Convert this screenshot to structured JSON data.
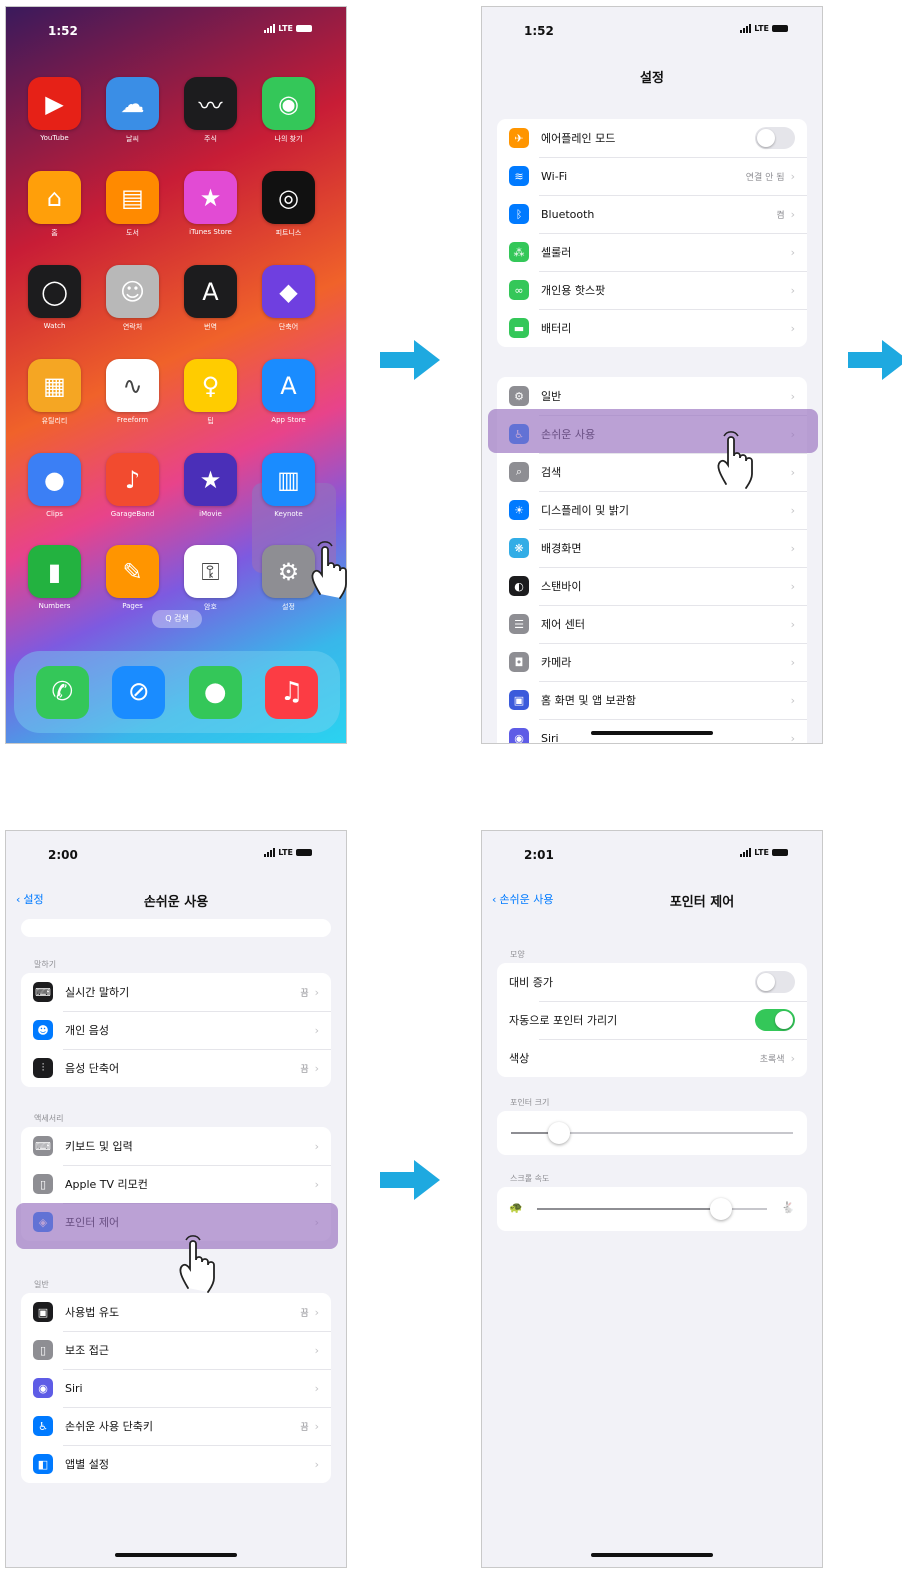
{
  "colors": {
    "arrow": "#1ea9e0",
    "highlight": "#9b6fc2",
    "ios_blue": "#007aff",
    "toggle_on": "#34c759"
  },
  "phone1": {
    "time": "1:52",
    "network": "LTE",
    "apps": [
      {
        "label": "YouTube",
        "icon": "play-icon",
        "color": "#e62117",
        "glyph": "▶"
      },
      {
        "label": "날씨",
        "icon": "weather-icon",
        "color": "#3a8ee6",
        "glyph": "☁"
      },
      {
        "label": "주식",
        "icon": "stocks-icon",
        "color": "#1c1c1e",
        "glyph": "〰"
      },
      {
        "label": "나의 찾기",
        "icon": "findmy-icon",
        "color": "#34c759",
        "glyph": "◉"
      },
      {
        "label": "홈",
        "icon": "home-icon",
        "color": "#ff9f0a",
        "glyph": "⌂"
      },
      {
        "label": "도서",
        "icon": "books-icon",
        "color": "#ff8a00",
        "glyph": "▤"
      },
      {
        "label": "iTunes Store",
        "icon": "star-icon",
        "color": "#e24bd4",
        "glyph": "★"
      },
      {
        "label": "피트니스",
        "icon": "fitness-icon",
        "color": "#111111",
        "glyph": "◎"
      },
      {
        "label": "Watch",
        "icon": "watch-icon",
        "color": "#1c1c1e",
        "glyph": "◯"
      },
      {
        "label": "연락처",
        "icon": "contacts-icon",
        "color": "#b8b8b8",
        "glyph": "☺"
      },
      {
        "label": "번역",
        "icon": "translate-icon",
        "color": "#1c1c1e",
        "glyph": "A"
      },
      {
        "label": "단축어",
        "icon": "shortcuts-icon",
        "color": "#6f3fe0",
        "glyph": "◆"
      },
      {
        "label": "유틸리티",
        "icon": "utilities-icon",
        "color": "#f5a623",
        "glyph": "▦"
      },
      {
        "label": "Freeform",
        "icon": "freeform-icon",
        "color": "#ffffff",
        "glyph": "∿"
      },
      {
        "label": "팁",
        "icon": "tips-icon",
        "color": "#ffcc00",
        "glyph": "♀"
      },
      {
        "label": "App Store",
        "icon": "appstore-icon",
        "color": "#1a8cff",
        "glyph": "A"
      },
      {
        "label": "Clips",
        "icon": "clips-icon",
        "color": "#3b7ff5",
        "glyph": "●"
      },
      {
        "label": "GarageBand",
        "icon": "garageband-icon",
        "color": "#f24b2f",
        "glyph": "♪"
      },
      {
        "label": "iMovie",
        "icon": "imovie-icon",
        "color": "#4a2fb8",
        "glyph": "★"
      },
      {
        "label": "Keynote",
        "icon": "keynote-icon",
        "color": "#1a8cff",
        "glyph": "▥"
      },
      {
        "label": "Numbers",
        "icon": "numbers-icon",
        "color": "#23b240",
        "glyph": "▮"
      },
      {
        "label": "Pages",
        "icon": "pages-icon",
        "color": "#ff9500",
        "glyph": "✎"
      },
      {
        "label": "암호",
        "icon": "passwords-icon",
        "color": "#ffffff",
        "glyph": "⚿"
      },
      {
        "label": "설정",
        "icon": "settings-gear-icon",
        "color": "#8e8e93",
        "glyph": "⚙"
      }
    ],
    "search_label": "Q 검색",
    "dock": [
      {
        "icon": "phone-icon",
        "color": "#34c759",
        "glyph": "✆"
      },
      {
        "icon": "safari-icon",
        "color": "#1a8cff",
        "glyph": "⊘"
      },
      {
        "icon": "messages-icon",
        "color": "#34c759",
        "glyph": "●"
      },
      {
        "icon": "music-icon",
        "color": "#fc3c44",
        "glyph": "♫"
      }
    ]
  },
  "phone2": {
    "time": "1:52",
    "network": "LTE",
    "title": "설정",
    "group1": [
      {
        "label": "에어플레인 모드",
        "icon": "airplane-icon",
        "color": "#ff9500",
        "glyph": "✈",
        "toggle": true
      },
      {
        "label": "Wi-Fi",
        "icon": "wifi-icon",
        "color": "#007aff",
        "glyph": "≋",
        "value": "연결 안 됨"
      },
      {
        "label": "Bluetooth",
        "icon": "bluetooth-icon",
        "color": "#007aff",
        "glyph": "ᛒ",
        "value": "켬"
      },
      {
        "label": "셀룰러",
        "icon": "cellular-icon",
        "color": "#34c759",
        "glyph": "⁂"
      },
      {
        "label": "개인용 핫스팟",
        "icon": "hotspot-icon",
        "color": "#34c759",
        "glyph": "∞"
      },
      {
        "label": "배터리",
        "icon": "battery-icon",
        "color": "#34c759",
        "glyph": "▬"
      }
    ],
    "group2": [
      {
        "label": "일반",
        "icon": "gear-icon",
        "color": "#8e8e93",
        "glyph": "⚙"
      },
      {
        "label": "손쉬운 사용",
        "icon": "accessibility-icon",
        "color": "#007aff",
        "glyph": "♿"
      },
      {
        "label": "검색",
        "icon": "search-icon",
        "color": "#8e8e93",
        "glyph": "⌕"
      },
      {
        "label": "디스플레이 및 밝기",
        "icon": "brightness-icon",
        "color": "#007aff",
        "glyph": "☀"
      },
      {
        "label": "배경화면",
        "icon": "wallpaper-icon",
        "color": "#32ade6",
        "glyph": "❋"
      },
      {
        "label": "스탠바이",
        "icon": "standby-icon",
        "color": "#1c1c1e",
        "glyph": "◐"
      },
      {
        "label": "제어 센터",
        "icon": "control-center-icon",
        "color": "#8e8e93",
        "glyph": "☰"
      },
      {
        "label": "카메라",
        "icon": "camera-icon",
        "color": "#8e8e93",
        "glyph": "◘"
      },
      {
        "label": "홈 화면 및 앱 보관함",
        "icon": "homescreen-icon",
        "color": "#3b5bdb",
        "glyph": "▣"
      },
      {
        "label": "Siri",
        "icon": "siri-icon",
        "color": "#5e5ce6",
        "glyph": "◉"
      }
    ]
  },
  "phone3": {
    "time": "2:00",
    "network": "LTE",
    "back_label": "설정",
    "title": "손쉬운 사용",
    "sections": [
      {
        "header": "말하기",
        "rows": [
          {
            "label": "실시간 말하기",
            "icon": "keyboard-icon",
            "color": "#1c1c1e",
            "glyph": "⌨",
            "value": "끔"
          },
          {
            "label": "개인 음성",
            "icon": "person-icon",
            "color": "#007aff",
            "glyph": "☻"
          },
          {
            "label": "음성 단축어",
            "icon": "waveform-icon",
            "color": "#1c1c1e",
            "glyph": "⫶",
            "value": "끔"
          }
        ]
      },
      {
        "header": "액세서리",
        "rows": [
          {
            "label": "키보드 및 입력",
            "icon": "keyboard-icon",
            "color": "#8e8e93",
            "glyph": "⌨"
          },
          {
            "label": "Apple TV 리모컨",
            "icon": "remote-icon",
            "color": "#8e8e93",
            "glyph": "▯"
          },
          {
            "label": "포인터 제어",
            "icon": "pointer-icon",
            "color": "#007aff",
            "glyph": "◈"
          }
        ]
      },
      {
        "header": "일반",
        "rows": [
          {
            "label": "사용법 유도",
            "icon": "lock-icon",
            "color": "#1c1c1e",
            "glyph": "▣",
            "value": "끔"
          },
          {
            "label": "보조 접근",
            "icon": "assistive-icon",
            "color": "#8e8e93",
            "glyph": "▯"
          },
          {
            "label": "Siri",
            "icon": "siri-icon",
            "color": "#5e5ce6",
            "glyph": "◉"
          },
          {
            "label": "손쉬운 사용 단축키",
            "icon": "accessibility-icon",
            "color": "#007aff",
            "glyph": "♿",
            "value": "끔"
          },
          {
            "label": "앱별 설정",
            "icon": "app-settings-icon",
            "color": "#007aff",
            "glyph": "◧"
          }
        ]
      }
    ]
  },
  "phone4": {
    "time": "2:01",
    "network": "LTE",
    "back_label": "손쉬운 사용",
    "title": "포인터 제어",
    "appearance_header": "모양",
    "rows": [
      {
        "label": "대비 증가",
        "toggle": false
      },
      {
        "label": "자동으로 포인터 가리기",
        "toggle": true
      },
      {
        "label": "색상",
        "value": "초록색"
      }
    ],
    "pointer_size_header": "포인터 크기",
    "pointer_size_level": 0.17,
    "scroll_speed_header": "스크롤 속도",
    "scroll_speed_level": 0.8
  }
}
